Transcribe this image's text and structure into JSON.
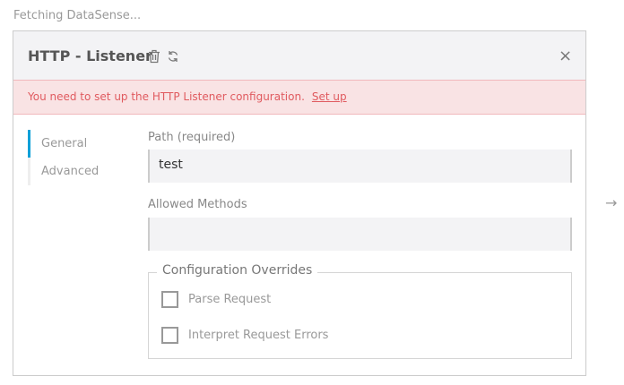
{
  "status_text": "Fetching DataSense...",
  "panel": {
    "title": "HTTP - Listener",
    "icons": {
      "delete": "trash-icon",
      "refresh": "refresh-icon",
      "close": "close-icon"
    },
    "close_glyph": "×"
  },
  "alert": {
    "message": "You need to set up the HTTP Listener configuration.",
    "link": "Set up",
    "color": "#e05a5f"
  },
  "sidebar": {
    "items": [
      {
        "label": "General",
        "active": true
      },
      {
        "label": "Advanced",
        "active": false
      }
    ]
  },
  "form": {
    "path": {
      "label": "Path (required)",
      "value": "test"
    },
    "allowed_methods": {
      "label": "Allowed Methods",
      "value": ""
    },
    "overrides": {
      "legend": "Configuration Overrides",
      "options": [
        {
          "label": "Parse Request",
          "checked": false
        },
        {
          "label": "Interpret Request Errors",
          "checked": false
        }
      ]
    }
  },
  "arrow_glyph": "→",
  "accent": "#0ea0d8"
}
